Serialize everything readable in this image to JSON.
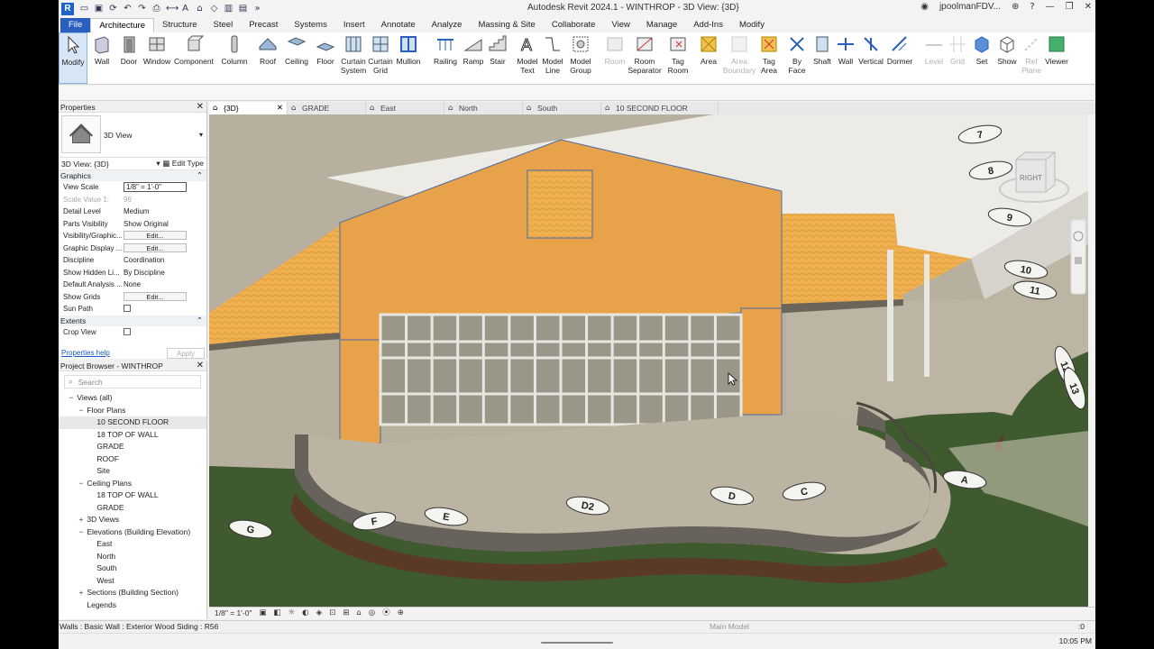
{
  "window": {
    "title": "Autodesk Revit 2024.1 - WINTHROP - 3D View: {3D}",
    "user": "jpoolmanFDV...",
    "logo": "R"
  },
  "ribbon_tabs": [
    "File",
    "Architecture",
    "Structure",
    "Steel",
    "Precast",
    "Systems",
    "Insert",
    "Annotate",
    "Analyze",
    "Massing & Site",
    "Collaborate",
    "View",
    "Manage",
    "Add-Ins",
    "Modify"
  ],
  "active_tab": "Architecture",
  "ribbon": {
    "modify": "Modify",
    "wall": "Wall",
    "door": "Door",
    "window": "Window",
    "component": "Component",
    "column": "Column",
    "roof": "Roof",
    "ceiling": "Ceiling",
    "floor": "Floor",
    "curtain_system": "Curtain System",
    "curtain_grid": "Curtain Grid",
    "mullion": "Mullion",
    "railing": "Railing",
    "ramp": "Ramp",
    "stair": "Stair",
    "model_text": "Model Text",
    "model_line": "Model Line",
    "model_group": "Model Group",
    "room": "Room",
    "room_separator": "Room Separator",
    "tag_room": "Tag Room",
    "area": "Area",
    "area_boundary": "Area Boundary",
    "tag_area": "Tag Area",
    "by_face": "By Face",
    "shaft": "Shaft",
    "wall_opening": "Wall",
    "vertical": "Vertical",
    "dormer": "Dormer",
    "level": "Level",
    "grid": "Grid",
    "set": "Set",
    "show": "Show",
    "ref_plane": "Ref Plane",
    "viewer": "Viewer"
  },
  "properties": {
    "title": "Properties",
    "type_name": "3D View",
    "instance": "3D View: {3D}",
    "edit_type": "Edit Type",
    "group_graphics": "Graphics",
    "rows": [
      {
        "k": "View Scale",
        "v": "1/8\" = 1'-0\""
      },
      {
        "k": "Scale Value    1:",
        "v": "96"
      },
      {
        "k": "Detail Level",
        "v": "Medium"
      },
      {
        "k": "Parts Visibility",
        "v": "Show Original"
      },
      {
        "k": "Visibility/Graphic...",
        "v": "Edit..."
      },
      {
        "k": "Graphic Display ...",
        "v": "Edit..."
      },
      {
        "k": "Discipline",
        "v": "Coordination"
      },
      {
        "k": "Show Hidden Li...",
        "v": "By Discipline"
      },
      {
        "k": "Default Analysis ...",
        "v": "None"
      },
      {
        "k": "Show Grids",
        "v": "Edit..."
      },
      {
        "k": "Sun Path",
        "v": ""
      }
    ],
    "group_extents": "Extents",
    "crop_view": "Crop View",
    "help": "Properties help",
    "apply": "Apply"
  },
  "browser": {
    "title": "Project Browser - WINTHROP",
    "search_placeholder": "Search",
    "items": [
      {
        "label": "Views (all)",
        "level": 0,
        "exp": "−"
      },
      {
        "label": "Floor Plans",
        "level": 1,
        "exp": "−"
      },
      {
        "label": "10 SECOND FLOOR",
        "level": 2,
        "exp": "",
        "selected": true
      },
      {
        "label": "18 TOP OF WALL",
        "level": 2,
        "exp": ""
      },
      {
        "label": "GRADE",
        "level": 2,
        "exp": ""
      },
      {
        "label": "ROOF",
        "level": 2,
        "exp": ""
      },
      {
        "label": "Site",
        "level": 2,
        "exp": ""
      },
      {
        "label": "Ceiling Plans",
        "level": 1,
        "exp": "−"
      },
      {
        "label": "18 TOP OF WALL",
        "level": 2,
        "exp": ""
      },
      {
        "label": "GRADE",
        "level": 2,
        "exp": ""
      },
      {
        "label": "3D Views",
        "level": 1,
        "exp": "+"
      },
      {
        "label": "Elevations (Building Elevation)",
        "level": 1,
        "exp": "−"
      },
      {
        "label": "East",
        "level": 2,
        "exp": ""
      },
      {
        "label": "North",
        "level": 2,
        "exp": ""
      },
      {
        "label": "South",
        "level": 2,
        "exp": ""
      },
      {
        "label": "West",
        "level": 2,
        "exp": ""
      },
      {
        "label": "Sections (Building Section)",
        "level": 1,
        "exp": "+"
      },
      {
        "label": "Legends",
        "level": 1,
        "exp": ""
      }
    ]
  },
  "view_tabs": [
    {
      "label": "{3D}",
      "active": true
    },
    {
      "label": "GRADE",
      "active": false
    },
    {
      "label": "East",
      "active": false
    },
    {
      "label": "North",
      "active": false
    },
    {
      "label": "South",
      "active": false
    },
    {
      "label": "10 SECOND FLOOR",
      "active": false
    }
  ],
  "view_control": {
    "scale": "1/8\" = 1'-0\""
  },
  "viewcube_label": "RIGHT",
  "grid_bubbles": [
    "7",
    "8",
    "9",
    "10",
    "11",
    "12",
    "13",
    "A",
    "C",
    "D",
    "D2",
    "E",
    "F",
    "G"
  ],
  "status": {
    "text": "Walls : Basic Wall : Exterior Wood Siding : R56",
    "model": "Main Model",
    "filter": ":0"
  },
  "taskbar": {
    "time": "10:05 PM"
  },
  "colors": {
    "siding": "#e8a24a",
    "roof_shingle": "#f0b050",
    "roof_top": "#ecebe6",
    "ground": "#bcb5a3",
    "grass": "#3f5a2f",
    "accent": "#2a5fbf"
  }
}
